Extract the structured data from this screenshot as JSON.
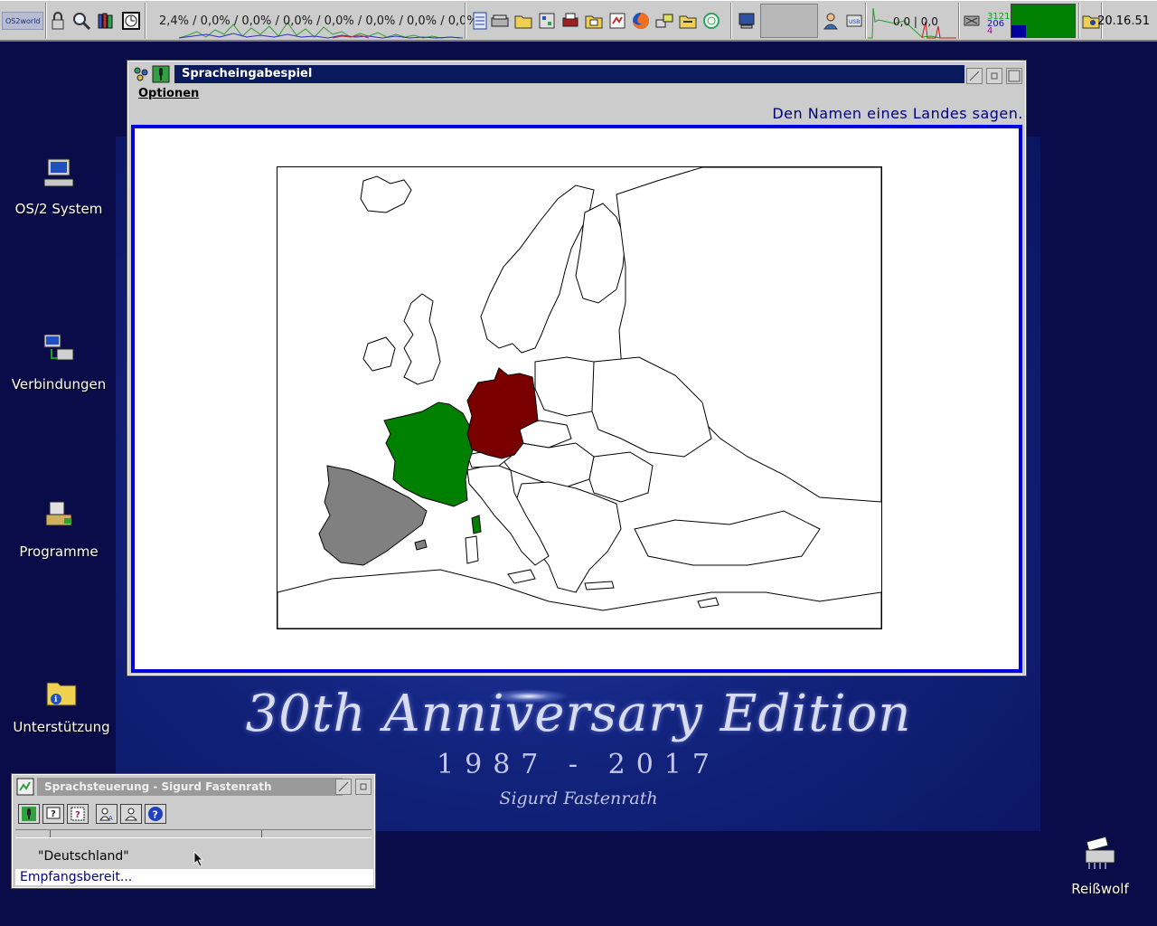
{
  "taskbar": {
    "logo_label": "OS2world",
    "cpu_readout": "2,4% / 0,0% / 0,0% / 0,0% / 0,0% / 0,0% / 0,0% / 0,0%",
    "net_readout": "0,0 | 0,0",
    "mem_top": "3121",
    "mem_mid": "206",
    "mem_bot": "4",
    "clock": "20.16.51"
  },
  "desktop": {
    "icons": [
      {
        "label": "OS/2 System"
      },
      {
        "label": "Verbindungen"
      },
      {
        "label": "Programme"
      },
      {
        "label": "Unterstützung"
      },
      {
        "label": "Reißwolf"
      }
    ],
    "wallpaper": {
      "title": "30th Anniversary Edition",
      "years": "1987 - 2017",
      "author": "Sigurd Fastenrath"
    }
  },
  "main_window": {
    "title": "Spracheingabespiel",
    "menu": [
      "Optionen"
    ],
    "instruction": "Den Namen eines Landes sagen.",
    "map": {
      "highlighted": [
        {
          "country": "Germany",
          "color": "#7a0000"
        },
        {
          "country": "France",
          "color": "#008000"
        },
        {
          "country": "Spain",
          "color": "#808080"
        }
      ]
    }
  },
  "voice_window": {
    "title": "Sprachsteuerung - Sigurd Fastenrath",
    "recognized": "\"Deutschland\"",
    "status": "Empfangsbereit..."
  },
  "colors": {
    "accent_blue": "#0000e0",
    "titlebar_active": "#0a1a5c",
    "desktop_bg": "#0a0c4a"
  }
}
